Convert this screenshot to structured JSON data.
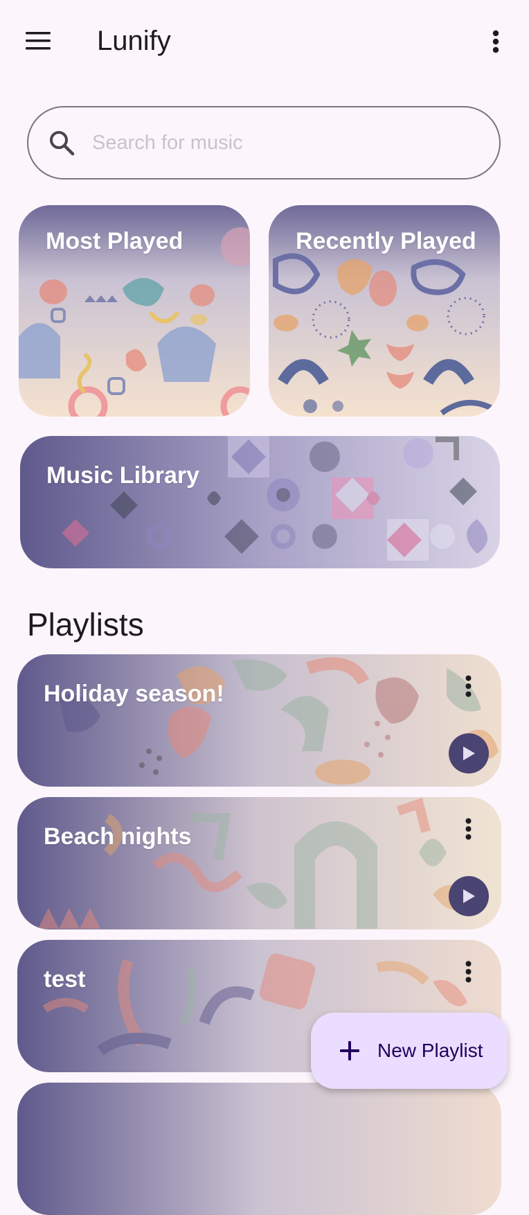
{
  "appbar": {
    "title": "Lunify",
    "menu_icon": "hamburger-menu-icon",
    "more_icon": "more-vert-icon"
  },
  "search": {
    "placeholder": "Search for music",
    "value": "",
    "icon": "search-icon"
  },
  "tiles": {
    "most_played": {
      "label": "Most Played"
    },
    "recently_played": {
      "label": "Recently Played"
    },
    "music_library": {
      "label": "Music Library"
    }
  },
  "playlists": {
    "title": "Playlists",
    "items": [
      {
        "name": "Holiday season!"
      },
      {
        "name": "Beach nights"
      },
      {
        "name": "test"
      }
    ]
  },
  "fab": {
    "label": "New Playlist",
    "icon": "plus-icon"
  },
  "colors": {
    "background": "#fdf5fc",
    "accent": "#4a4473",
    "fab_bg": "#eaddff",
    "fab_text": "#21005d"
  }
}
